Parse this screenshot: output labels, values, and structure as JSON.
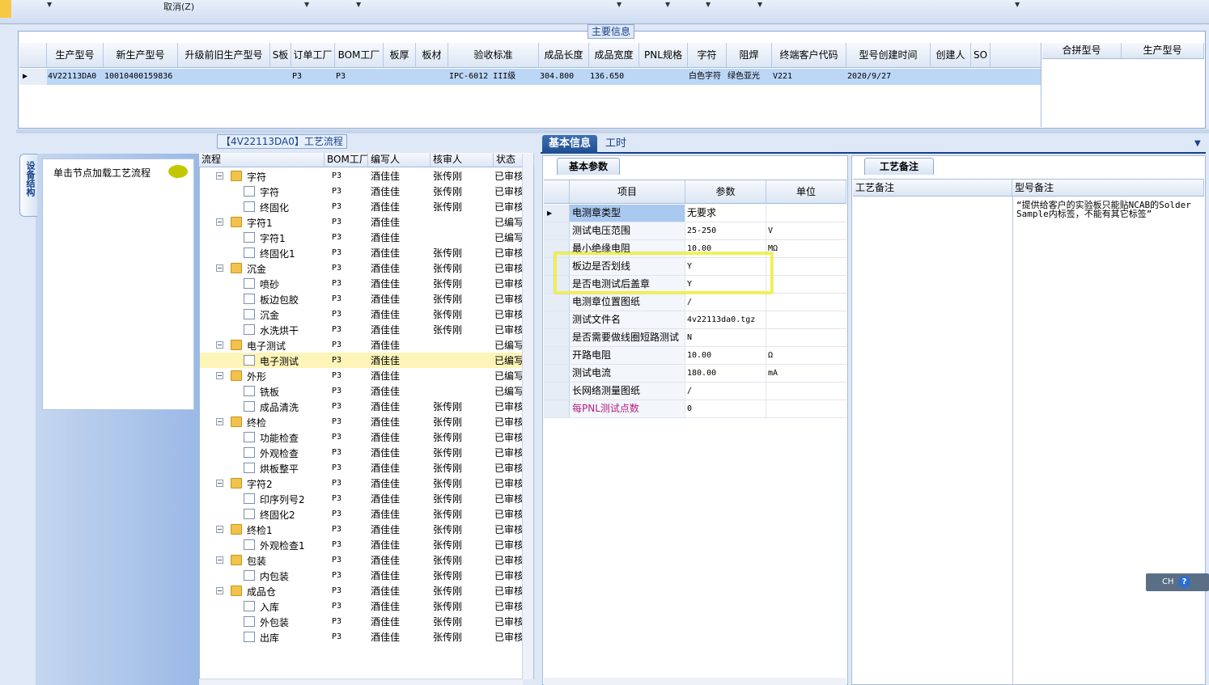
{
  "toolbar": {
    "cancel_label": "取消(Z)"
  },
  "main_info": {
    "title": "主要信息",
    "columns": [
      "生产型号",
      "新生产型号",
      "升级前旧生产型号",
      "S板",
      "订单工厂",
      "BOM工厂",
      "板厚",
      "板材",
      "验收标准",
      "成品长度",
      "成品宽度",
      "PNL规格",
      "字符",
      "阻焊",
      "终端客户代码",
      "型号创建时间",
      "创建人",
      "SO"
    ],
    "row": [
      "4V22113DA0",
      "10010400159836",
      "",
      "",
      "P3",
      "P3",
      "",
      "",
      "IPC-6012 III级",
      "304.800",
      "136.650",
      "",
      "白色字符",
      "绿色亚光",
      "V221",
      "2020/9/27",
      "",
      ""
    ],
    "right_columns": [
      "合拼型号",
      "生产型号"
    ]
  },
  "process": {
    "title": "【4V22113DA0】工艺流程",
    "side_tab": "设备结构",
    "load_hint": "单击节点加载工艺流程",
    "columns": [
      "流程",
      "BOM工厂",
      "编写人",
      "核审人",
      "状态"
    ],
    "rows": [
      {
        "level": 0,
        "type": "folder",
        "name": "字符",
        "bom": "P3",
        "writer": "酒佳佳",
        "reviewer": "张传刚",
        "status": "已审核"
      },
      {
        "level": 1,
        "type": "doc",
        "name": "字符",
        "bom": "P3",
        "writer": "酒佳佳",
        "reviewer": "张传刚",
        "status": "已审核"
      },
      {
        "level": 1,
        "type": "doc",
        "name": "终固化",
        "bom": "P3",
        "writer": "酒佳佳",
        "reviewer": "张传刚",
        "status": "已审核"
      },
      {
        "level": 0,
        "type": "folder",
        "name": "字符1",
        "bom": "P3",
        "writer": "酒佳佳",
        "reviewer": "",
        "status": "已编写"
      },
      {
        "level": 1,
        "type": "doc",
        "name": "字符1",
        "bom": "P3",
        "writer": "酒佳佳",
        "reviewer": "",
        "status": "已编写"
      },
      {
        "level": 1,
        "type": "doc",
        "name": "终固化1",
        "bom": "P3",
        "writer": "酒佳佳",
        "reviewer": "张传刚",
        "status": "已审核"
      },
      {
        "level": 0,
        "type": "folder",
        "name": "沉金",
        "bom": "P3",
        "writer": "酒佳佳",
        "reviewer": "张传刚",
        "status": "已审核"
      },
      {
        "level": 1,
        "type": "doc",
        "name": "喷砂",
        "bom": "P3",
        "writer": "酒佳佳",
        "reviewer": "张传刚",
        "status": "已审核"
      },
      {
        "level": 1,
        "type": "doc",
        "name": "板边包胶",
        "bom": "P3",
        "writer": "酒佳佳",
        "reviewer": "张传刚",
        "status": "已审核"
      },
      {
        "level": 1,
        "type": "doc",
        "name": "沉金",
        "bom": "P3",
        "writer": "酒佳佳",
        "reviewer": "张传刚",
        "status": "已审核"
      },
      {
        "level": 1,
        "type": "doc",
        "name": "水洗烘干",
        "bom": "P3",
        "writer": "酒佳佳",
        "reviewer": "张传刚",
        "status": "已审核"
      },
      {
        "level": 0,
        "type": "folder",
        "name": "电子测试",
        "bom": "P3",
        "writer": "酒佳佳",
        "reviewer": "",
        "status": "已编写"
      },
      {
        "level": 1,
        "type": "doc",
        "name": "电子测试",
        "bom": "P3",
        "writer": "酒佳佳",
        "reviewer": "",
        "status": "已编写",
        "selected": true
      },
      {
        "level": 0,
        "type": "folder",
        "name": "外形",
        "bom": "P3",
        "writer": "酒佳佳",
        "reviewer": "",
        "status": "已编写"
      },
      {
        "level": 1,
        "type": "doc",
        "name": "铣板",
        "bom": "P3",
        "writer": "酒佳佳",
        "reviewer": "",
        "status": "已编写"
      },
      {
        "level": 1,
        "type": "doc",
        "name": "成品清洗",
        "bom": "P3",
        "writer": "酒佳佳",
        "reviewer": "张传刚",
        "status": "已审核"
      },
      {
        "level": 0,
        "type": "folder",
        "name": "终检",
        "bom": "P3",
        "writer": "酒佳佳",
        "reviewer": "张传刚",
        "status": "已审核"
      },
      {
        "level": 1,
        "type": "doc",
        "name": "功能检查",
        "bom": "P3",
        "writer": "酒佳佳",
        "reviewer": "张传刚",
        "status": "已审核"
      },
      {
        "level": 1,
        "type": "doc",
        "name": "外观检查",
        "bom": "P3",
        "writer": "酒佳佳",
        "reviewer": "张传刚",
        "status": "已审核"
      },
      {
        "level": 1,
        "type": "doc",
        "name": "烘板整平",
        "bom": "P3",
        "writer": "酒佳佳",
        "reviewer": "张传刚",
        "status": "已审核"
      },
      {
        "level": 0,
        "type": "folder",
        "name": "字符2",
        "bom": "P3",
        "writer": "酒佳佳",
        "reviewer": "张传刚",
        "status": "已审核"
      },
      {
        "level": 1,
        "type": "doc",
        "name": "印序列号2",
        "bom": "P3",
        "writer": "酒佳佳",
        "reviewer": "张传刚",
        "status": "已审核"
      },
      {
        "level": 1,
        "type": "doc",
        "name": "终固化2",
        "bom": "P3",
        "writer": "酒佳佳",
        "reviewer": "张传刚",
        "status": "已审核"
      },
      {
        "level": 0,
        "type": "folder",
        "name": "终检1",
        "bom": "P3",
        "writer": "酒佳佳",
        "reviewer": "张传刚",
        "status": "已审核"
      },
      {
        "level": 1,
        "type": "doc",
        "name": "外观检查1",
        "bom": "P3",
        "writer": "酒佳佳",
        "reviewer": "张传刚",
        "status": "已审核"
      },
      {
        "level": 0,
        "type": "folder",
        "name": "包装",
        "bom": "P3",
        "writer": "酒佳佳",
        "reviewer": "张传刚",
        "status": "已审核"
      },
      {
        "level": 1,
        "type": "doc",
        "name": "内包装",
        "bom": "P3",
        "writer": "酒佳佳",
        "reviewer": "张传刚",
        "status": "已审核"
      },
      {
        "level": 0,
        "type": "folder",
        "name": "成品仓",
        "bom": "P3",
        "writer": "酒佳佳",
        "reviewer": "张传刚",
        "status": "已审核"
      },
      {
        "level": 1,
        "type": "doc",
        "name": "入库",
        "bom": "P3",
        "writer": "酒佳佳",
        "reviewer": "张传刚",
        "status": "已审核"
      },
      {
        "level": 1,
        "type": "doc",
        "name": "外包装",
        "bom": "P3",
        "writer": "酒佳佳",
        "reviewer": "张传刚",
        "status": "已审核"
      },
      {
        "level": 1,
        "type": "doc",
        "name": "出库",
        "bom": "P3",
        "writer": "酒佳佳",
        "reviewer": "张传刚",
        "status": "已审核"
      }
    ]
  },
  "tabs": {
    "basic": "基本信息",
    "hours": "工时"
  },
  "params": {
    "title": "基本参数",
    "columns": [
      "项目",
      "参数",
      "单位"
    ],
    "rows": [
      {
        "item": "电测章类型",
        "value": "无要求",
        "unit": "",
        "selected": true
      },
      {
        "item": "测试电压范围",
        "value": "25-250",
        "unit": "V"
      },
      {
        "item": "最小绝缘电阻",
        "value": "10.00",
        "unit": "MΩ"
      },
      {
        "item": "板边是否划线",
        "value": "Y",
        "unit": ""
      },
      {
        "item": "是否电测试后盖章",
        "value": "Y",
        "unit": ""
      },
      {
        "item": "电测章位置图纸",
        "value": "/",
        "unit": ""
      },
      {
        "item": "测试文件名",
        "value": "4v22113da0.tgz",
        "unit": ""
      },
      {
        "item": "是否需要做线圈短路测试",
        "value": "N",
        "unit": ""
      },
      {
        "item": "开路电阻",
        "value": "10.00",
        "unit": "Ω"
      },
      {
        "item": "测试电流",
        "value": "180.00",
        "unit": "mA"
      },
      {
        "item": "长网络测量图纸",
        "value": "/",
        "unit": ""
      },
      {
        "item": "每PNL测试点数",
        "value": "0",
        "unit": "",
        "pink": true
      }
    ]
  },
  "notes": {
    "title": "工艺备注",
    "columns": [
      "工艺备注",
      "型号备注"
    ],
    "remark": "“提供给客户的实验板只能贴NCAB的Solder Sample内标签，不能有其它标签”"
  },
  "ime": {
    "lang": "CH",
    "help": "?"
  }
}
